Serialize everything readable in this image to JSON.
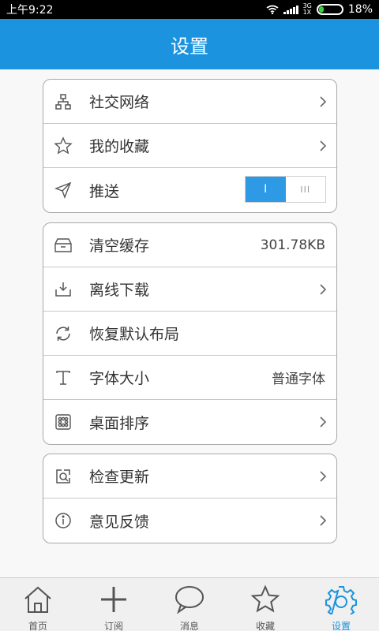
{
  "status_bar": {
    "time": "上午9:22",
    "network_top": "3G",
    "network_bottom": "1X",
    "battery": "18%",
    "battery_color": "#3ad13a"
  },
  "header": {
    "title": "设置",
    "color": "#1b93de"
  },
  "groups": [
    {
      "items": [
        {
          "label": "社交网络",
          "icon": "network-icon",
          "control": "chevron"
        },
        {
          "label": "我的收藏",
          "icon": "star-icon",
          "control": "chevron"
        },
        {
          "label": "推送",
          "icon": "send-icon",
          "control": "toggle",
          "toggle_on": "I",
          "toggle_off": "III",
          "toggle_state": "on"
        }
      ]
    },
    {
      "items": [
        {
          "label": "清空缓存",
          "icon": "cache-icon",
          "value": "301.78KB"
        },
        {
          "label": "离线下载",
          "icon": "download-icon",
          "control": "chevron"
        },
        {
          "label": "恢复默认布局",
          "icon": "refresh-icon"
        },
        {
          "label": "字体大小",
          "icon": "font-icon",
          "value": "普通字体"
        },
        {
          "label": "桌面排序",
          "icon": "grid-icon",
          "control": "chevron"
        }
      ]
    },
    {
      "items": [
        {
          "label": "检查更新",
          "icon": "update-icon",
          "control": "chevron"
        },
        {
          "label": "意见反馈",
          "icon": "info-icon",
          "control": "chevron"
        }
      ]
    }
  ],
  "tabbar": {
    "tabs": [
      {
        "label": "首页",
        "icon": "home-icon"
      },
      {
        "label": "订阅",
        "icon": "plus-icon"
      },
      {
        "label": "消息",
        "icon": "message-icon"
      },
      {
        "label": "收藏",
        "icon": "star-outline-icon"
      },
      {
        "label": "设置",
        "icon": "settings-gear-icon",
        "active": true
      }
    ],
    "active_color": "#1b93de"
  }
}
